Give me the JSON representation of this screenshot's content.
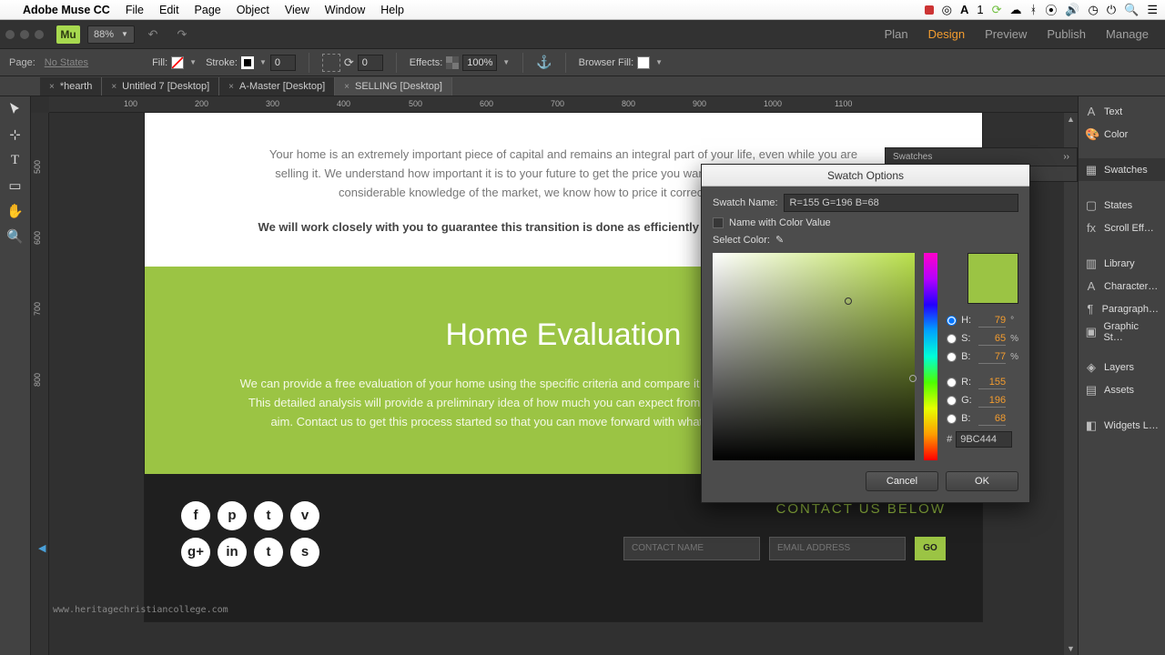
{
  "mac": {
    "appname": "Adobe Muse CC",
    "menu": [
      "File",
      "Edit",
      "Page",
      "Object",
      "View",
      "Window",
      "Help"
    ],
    "a_badge": "1"
  },
  "zoom": "88%",
  "workspace": [
    "Plan",
    "Design",
    "Preview",
    "Publish",
    "Manage"
  ],
  "workspace_active": "Design",
  "ctrl": {
    "page": "Page:",
    "nostates": "No States",
    "fill": "Fill:",
    "stroke": "Stroke:",
    "stroke_val": "0",
    "rotate_val": "0",
    "effects": "Effects:",
    "opacity": "100%",
    "browserfill": "Browser Fill:"
  },
  "tabs": [
    {
      "name": "*hearth"
    },
    {
      "name": "Untitled 7 [Desktop]"
    },
    {
      "name": "A-Master [Desktop]"
    },
    {
      "name": "SELLING [Desktop]",
      "active": true
    }
  ],
  "ruler_h": [
    "100",
    "200",
    "300",
    "400",
    "500",
    "600",
    "700",
    "800",
    "900",
    "1000",
    "1100"
  ],
  "ruler_v": [
    "500",
    "600",
    "700",
    "800"
  ],
  "page": {
    "intro1": "Your home is an extremely important piece of capital and remains an integral part of your life, even while you are selling it. We understand how important it is to your future to get the price you want on your home and with our considerable knowledge of the market, we know how to price it correctly, the first time.",
    "intro_bold": "We will work closely with you to guarantee this transition is done as efficiently and successfully as possible.",
    "green_title": "Home Evaluation",
    "green_p": "We can provide a free evaluation of your home using the specific criteria and compare it with relevant current market prices. This detailed analysis will provide a preliminary idea of how much you can expect from the market and where you should aim. Contact us to get this process started so that you can move forward with what the future holds next for you.",
    "contact_title": "CONTACT US BELOW",
    "contact_name": "CONTACT NAME",
    "email": "EMAIL ADDRESS",
    "go": "GO",
    "social": [
      "f",
      "p",
      "t",
      "v",
      "g+",
      "in",
      "t",
      "s"
    ]
  },
  "swatches_panel": {
    "title": "Swatches"
  },
  "dialog": {
    "title": "Swatch Options",
    "name_lbl": "Swatch Name:",
    "name_val": "R=155 G=196 B=68",
    "namecb": "Name with Color Value",
    "select": "Select Color:",
    "H": "H:",
    "S": "S:",
    "B": "B:",
    "R": "R:",
    "G": "G:",
    "Bch": "B:",
    "hv": "79",
    "sv": "65",
    "bv": "77",
    "rv": "155",
    "gv": "196",
    "bcv": "68",
    "deg": "°",
    "pct": "%",
    "hex": "9BC444",
    "cancel": "Cancel",
    "ok": "OK"
  },
  "rp": [
    {
      "ico": "A",
      "l": "Text"
    },
    {
      "ico": "🎨",
      "l": "Color"
    },
    {
      "gap": 1
    },
    {
      "ico": "▦",
      "l": "Swatches",
      "a": 1
    },
    {
      "gap": 1
    },
    {
      "ico": "▢",
      "l": "States"
    },
    {
      "ico": "fx",
      "l": "Scroll Eff…"
    },
    {
      "gap": 1
    },
    {
      "ico": "▥",
      "l": "Library"
    },
    {
      "ico": "A",
      "l": "Character…"
    },
    {
      "ico": "¶",
      "l": "Paragraph…"
    },
    {
      "ico": "▣",
      "l": "Graphic St…"
    },
    {
      "gap": 1
    },
    {
      "ico": "◈",
      "l": "Layers"
    },
    {
      "ico": "▤",
      "l": "Assets"
    },
    {
      "gap": 1
    },
    {
      "ico": "◧",
      "l": "Widgets L…"
    }
  ],
  "watermark": "www.heritagechristiancollege.com"
}
